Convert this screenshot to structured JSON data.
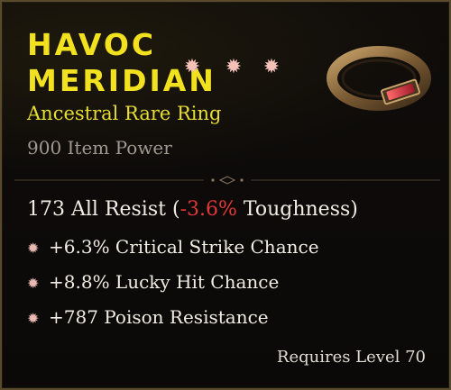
{
  "item": {
    "name_line1": "Havoc",
    "name_line2": "Meridian",
    "upgrade_icons": [
      "star-icon",
      "star-icon",
      "star-icon"
    ],
    "type": "Ancestral Rare Ring",
    "item_power": "900 Item Power",
    "image": "ring-icon"
  },
  "main_stat": {
    "text_before": "173 All Resist (",
    "delta": "-3.6%",
    "text_after": " Toughness)"
  },
  "affixes": [
    "+6.3% Critical Strike Chance",
    "+8.8% Lucky Hit Chance",
    "+787 Poison Resistance"
  ],
  "requirements": "Requires Level 70",
  "colors": {
    "name": "#f2e11f",
    "type": "#e8de33",
    "negative": "#e03838",
    "border": "#5a4a2c"
  }
}
